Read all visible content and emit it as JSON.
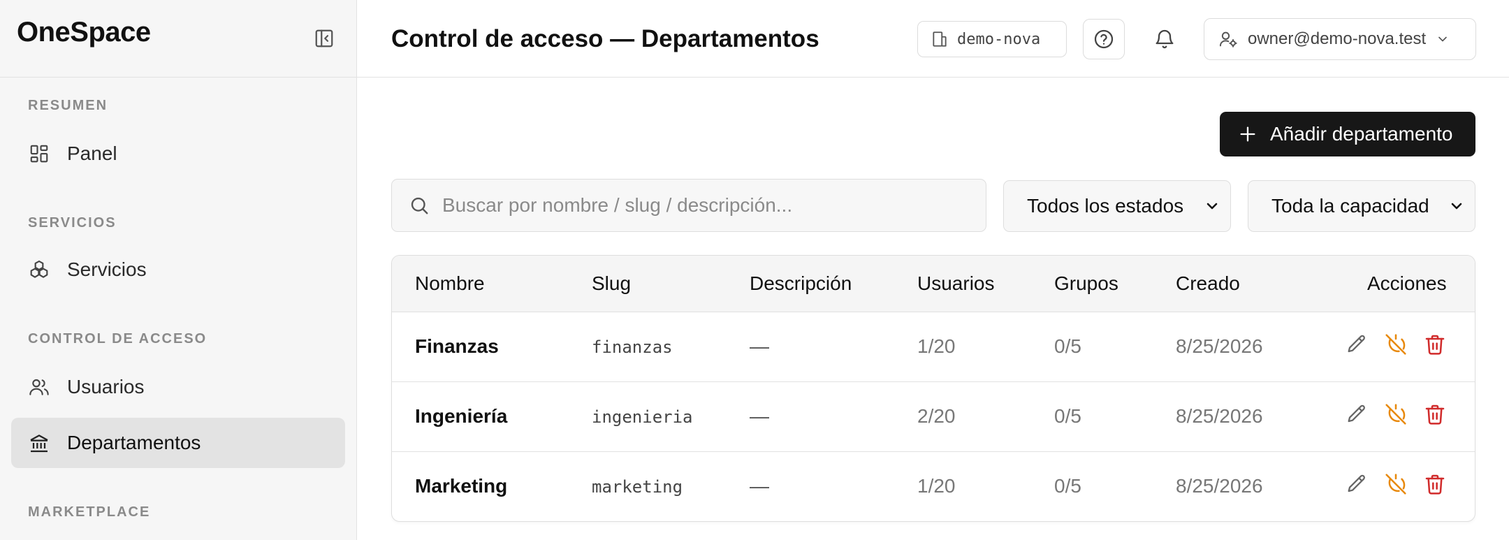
{
  "app": {
    "brand": "OneSpace"
  },
  "sidebar": {
    "sections": [
      {
        "label": "RESUMEN",
        "items": [
          {
            "label": "Panel",
            "icon": "dashboard-grid-icon"
          }
        ]
      },
      {
        "label": "SERVICIOS",
        "items": [
          {
            "label": "Servicios",
            "icon": "boxes-icon"
          }
        ]
      },
      {
        "label": "CONTROL DE ACCESO",
        "items": [
          {
            "label": "Usuarios",
            "icon": "users-icon"
          },
          {
            "label": "Departamentos",
            "icon": "landmark-icon",
            "active": true
          }
        ]
      },
      {
        "label": "MARKETPLACE",
        "items": []
      }
    ]
  },
  "header": {
    "title": "Control de acceso — Departamentos",
    "tenant": "demo-nova",
    "user": "owner@demo-nova.test"
  },
  "actions": {
    "add_label": "Añadir departamento"
  },
  "filters": {
    "search_placeholder": "Buscar por nombre / slug / descripción...",
    "status": "Todos los estados",
    "capacity": "Toda la capacidad"
  },
  "table": {
    "columns": [
      "Nombre",
      "Slug",
      "Descripción",
      "Usuarios",
      "Grupos",
      "Creado",
      "Acciones"
    ],
    "rows": [
      {
        "name": "Finanzas",
        "slug": "finanzas",
        "description": "—",
        "users": "1/20",
        "groups": "0/5",
        "created": "8/25/2026"
      },
      {
        "name": "Ingeniería",
        "slug": "ingenieria",
        "description": "—",
        "users": "2/20",
        "groups": "0/5",
        "created": "8/25/2026"
      },
      {
        "name": "Marketing",
        "slug": "marketing",
        "description": "—",
        "users": "1/20",
        "groups": "0/5",
        "created": "8/25/2026"
      }
    ]
  },
  "colors": {
    "accent_dark": "#171717",
    "warning": "#e8890c",
    "danger": "#d12b2b"
  }
}
